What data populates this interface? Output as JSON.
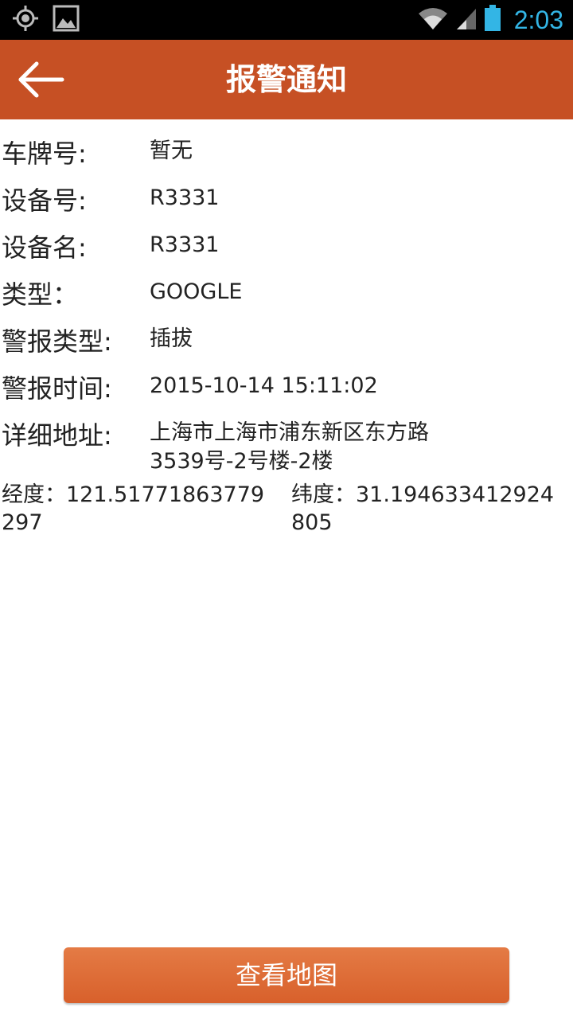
{
  "status_bar": {
    "time": "2:03",
    "icons": [
      "gps-icon",
      "image-icon",
      "wifi-icon",
      "signal-icon",
      "battery-icon"
    ],
    "time_color": "#33b5e5"
  },
  "app_bar": {
    "title": "报警通知",
    "back_icon": "arrow-left-icon",
    "background": "#c65024"
  },
  "details": [
    {
      "label": "车牌号:",
      "value": "暂无"
    },
    {
      "label": "设备号:",
      "value": "R3331"
    },
    {
      "label": "设备名:",
      "value": "R3331"
    },
    {
      "label": "类型：",
      "value": "GOOGLE"
    },
    {
      "label": "警报类型:",
      "value": "插拔"
    },
    {
      "label": "警报时间:",
      "value": "2015-10-14 15:11:02"
    },
    {
      "label": "详细地址:",
      "value": "上海市上海市浦东新区东方路3539号-2号楼-2楼"
    }
  ],
  "coordinates": {
    "longitude": "经度：121.51771863779297",
    "latitude": "纬度：31.194633412924805"
  },
  "map_button": {
    "label": "查看地图",
    "color": "#d8602b"
  }
}
